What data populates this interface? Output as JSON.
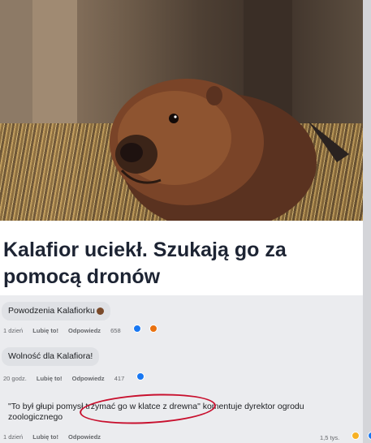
{
  "article": {
    "headline": "Kalafior uciekł. Szukają go za pomocą dronów",
    "image_subject": "beaver-photo"
  },
  "comments": [
    {
      "text": "Powodzenia Kalafiorku",
      "time": "1 dzień",
      "like_label": "Lubię to!",
      "reply_label": "Odpowiedz",
      "reaction_count": "658"
    },
    {
      "text": "Wolność dla Kalafiora!",
      "time": "20 godz.",
      "like_label": "Lubię to!",
      "reply_label": "Odpowiedz",
      "reaction_count": "417"
    },
    {
      "text": "\"To był głupi pomysł trzymać go w klatce z drewna\" komentuje dyrektor ogrodu zoologicznego",
      "time": "1 dzień",
      "like_label": "Lubię to!",
      "reply_label": "Odpowiedz",
      "reaction_count": "1,5 tys."
    }
  ],
  "colors": {
    "headline": "#1d2433",
    "annotation_circle": "#c8102e",
    "like": "#1877f2"
  }
}
